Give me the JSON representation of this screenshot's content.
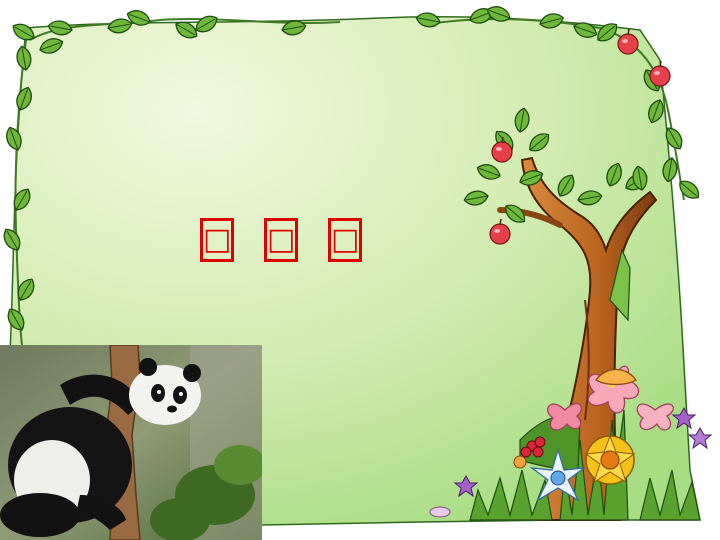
{
  "slide": {
    "title_chars": [
      "□",
      "□",
      "□"
    ]
  },
  "colors": {
    "background_start": "#f1f8de",
    "background_end": "#a9dd84",
    "title_red": "#e00000",
    "leaf_green": "#5aa22e",
    "trunk_brown": "#b8621f"
  },
  "icons": {
    "frame": "leafy-vine-frame-icon",
    "tree": "apple-tree-icon",
    "flowers": "flower-bouquet-icon",
    "photo": "panda-climbing-tree-photo"
  }
}
